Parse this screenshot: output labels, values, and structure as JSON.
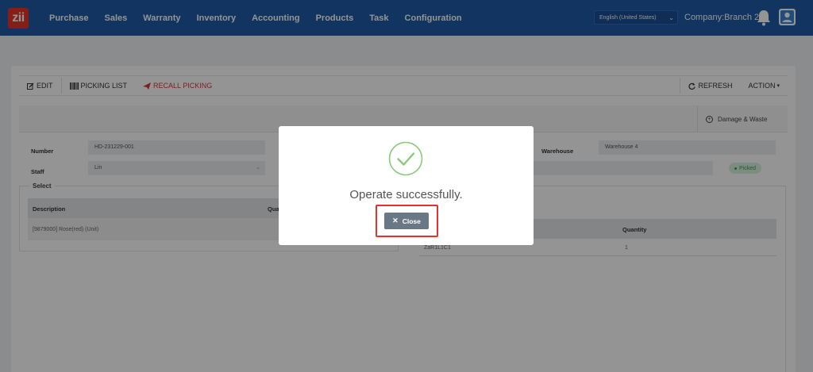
{
  "app": {
    "logo_text": "zii",
    "brand_color": "#1e5aa8",
    "logo_color": "#e8312a"
  },
  "nav": {
    "items": [
      {
        "label": "Purchase"
      },
      {
        "label": "Sales"
      },
      {
        "label": "Warranty"
      },
      {
        "label": "Inventory"
      },
      {
        "label": "Accounting"
      },
      {
        "label": "Products"
      },
      {
        "label": "Task"
      },
      {
        "label": "Configuration"
      }
    ],
    "language": "English (United States)",
    "company": "Company:Branch 2",
    "icons": [
      "bell-icon",
      "user-icon"
    ]
  },
  "toolbar": {
    "edit_label": "EDIT",
    "picking_list_label": "PICKING LIST",
    "recall_picking_label": "RECALL PICKING",
    "refresh_label": "REFRESH",
    "action_label": "ACTION"
  },
  "tabs": {
    "damage_waste_label": "Damage & Waste"
  },
  "form": {
    "number_label": "Number",
    "number_value": "HD-231229-001",
    "staff_label": "Staff",
    "staff_value": "Lin",
    "warehouse_label": "Warehouse",
    "warehouse_value": "Warehouse 4",
    "status_badge": "Picked"
  },
  "select_panel": {
    "legend": "Select",
    "columns": [
      "Description",
      "Qua"
    ],
    "rows": [
      {
        "description": "[9879000] Rose(red) (Unit)"
      }
    ]
  },
  "right_panel": {
    "columns": [
      "Quantity"
    ],
    "rows": [
      {
        "location": "ZaR1L1C1",
        "quantity": "1"
      }
    ]
  },
  "modal": {
    "message": "Operate successfully.",
    "close_label": "Close",
    "success_color": "#8bc97a",
    "highlight_color": "#e8302f"
  }
}
